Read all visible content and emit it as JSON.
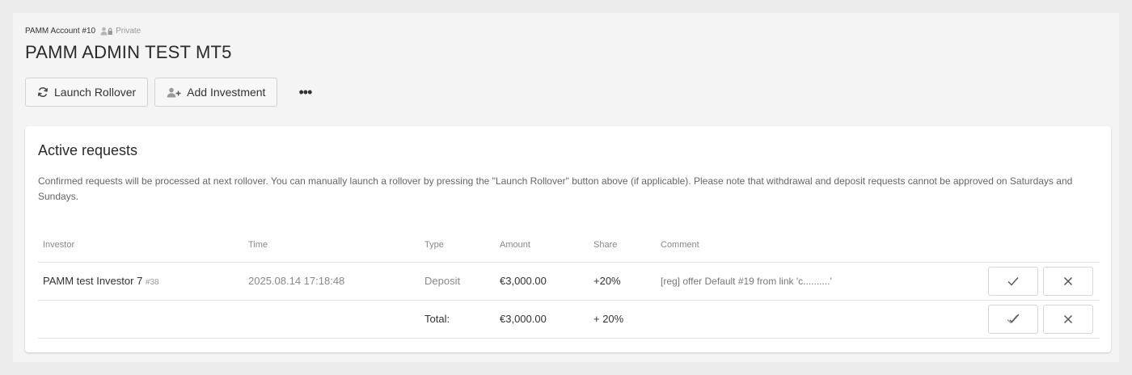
{
  "account": {
    "label": "PAMM Account #10",
    "visibility": "Private",
    "title": "PAMM ADMIN TEST MT5"
  },
  "toolbar": {
    "launch_rollover": "Launch Rollover",
    "add_investment": "Add Investment",
    "more": "•••"
  },
  "requests": {
    "title": "Active requests",
    "description": "Confirmed requests will be processed at next rollover. You can manually launch a rollover by pressing the \"Launch Rollover\" button above (if applicable). Please note that withdrawal and deposit requests cannot be approved on Saturdays and Sundays.",
    "columns": [
      "Investor",
      "Time",
      "Type",
      "Amount",
      "Share",
      "Comment"
    ],
    "rows": [
      {
        "investor": "PAMM test Investor 7",
        "investor_id": "#38",
        "time": "2025.08.14 17:18:48",
        "type": "Deposit",
        "amount": "€3,000.00",
        "share": "+20%",
        "comment": "[reg] offer Default #19 from link 'c..........'"
      }
    ],
    "total": {
      "label": "Total:",
      "amount": "€3,000.00",
      "share": "+ 20%"
    }
  }
}
